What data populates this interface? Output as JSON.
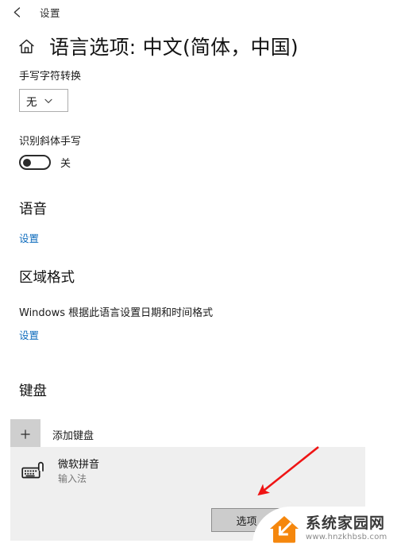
{
  "titlebar": {
    "back_icon": "back-arrow-icon",
    "title": "设置"
  },
  "header": {
    "home_icon": "home-icon",
    "title": "语言选项: 中文(简体，中国)"
  },
  "handwriting": {
    "label": "手写字符转换",
    "dropdown_value": "无",
    "dropdown_icon": "chevron-down-icon"
  },
  "cursive": {
    "label": "识别斜体手写",
    "toggle_state": "关",
    "toggle_on": false
  },
  "speech": {
    "heading": "语音",
    "link": "设置"
  },
  "region": {
    "heading": "区域格式",
    "description": "Windows 根据此语言设置日期和时间格式",
    "link": "设置"
  },
  "keyboard": {
    "heading": "键盘",
    "add_icon": "plus-icon",
    "add_label": "添加键盘",
    "items": [
      {
        "icon": "keyboard-icon",
        "name": "微软拼音",
        "subtitle": "输入法"
      }
    ],
    "options_button": "选项",
    "secondary_button": ""
  },
  "annotation": {
    "arrow_color": "#ef1414"
  },
  "watermark": {
    "logo_icon": "house-arrow-logo",
    "brand": "系统家园网",
    "url": "www.hnzkhbsb.com",
    "logo_color": "#f5870d"
  }
}
